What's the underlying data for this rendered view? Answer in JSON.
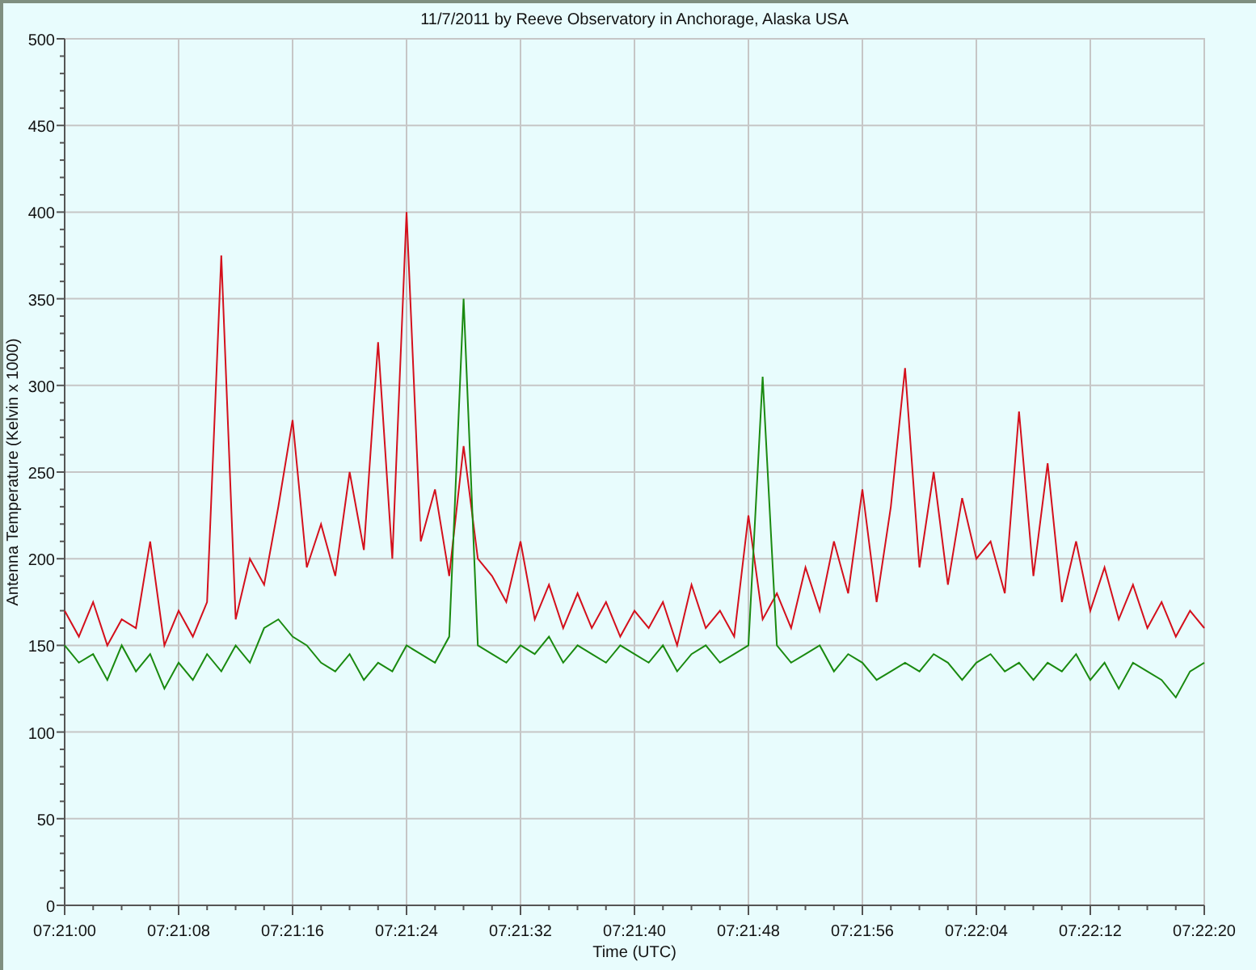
{
  "chart_data": {
    "type": "line",
    "title": "11/7/2011  by  Reeve Observatory  in  Anchorage, Alaska  USA",
    "xlabel": "Time (UTC)",
    "ylabel": "Antenna Temperature (Kelvin x 1000)",
    "categories": [
      "07:21:00",
      null,
      null,
      null,
      null,
      null,
      null,
      null,
      "07:21:08",
      null,
      null,
      null,
      null,
      null,
      null,
      null,
      "07:21:16",
      null,
      null,
      null,
      null,
      null,
      null,
      null,
      "07:21:24",
      null,
      null,
      null,
      null,
      null,
      null,
      null,
      "07:21:32",
      null,
      null,
      null,
      null,
      null,
      null,
      null,
      "07:21:40",
      null,
      null,
      null,
      null,
      null,
      null,
      null,
      "07:21:48",
      null,
      null,
      null,
      null,
      null,
      null,
      null,
      "07:21:56",
      null,
      null,
      null,
      null,
      null,
      null,
      null,
      "07:22:04",
      null,
      null,
      null,
      null,
      null,
      null,
      null,
      "07:22:12",
      null,
      null,
      null,
      null,
      null,
      null,
      null,
      "07:22:20"
    ],
    "series": [
      {
        "color": "#d4101c",
        "values": [
          170,
          155,
          175,
          150,
          165,
          160,
          210,
          150,
          170,
          155,
          175,
          375,
          165,
          200,
          185,
          230,
          280,
          195,
          220,
          190,
          250,
          205,
          325,
          200,
          400,
          210,
          240,
          190,
          265,
          200,
          190,
          175,
          210,
          165,
          185,
          160,
          180,
          160,
          175,
          155,
          170,
          160,
          175,
          150,
          185,
          160,
          170,
          155,
          225,
          165,
          180,
          160,
          195,
          170,
          210,
          180,
          240,
          175,
          230,
          310,
          195,
          250,
          185,
          235,
          200,
          210,
          180,
          285,
          190,
          255,
          175,
          210,
          170,
          195,
          165,
          185,
          160,
          175,
          155,
          170,
          160
        ]
      },
      {
        "color": "#1a8a10",
        "values": [
          150,
          140,
          145,
          130,
          150,
          135,
          145,
          125,
          140,
          130,
          145,
          135,
          150,
          140,
          160,
          165,
          155,
          150,
          140,
          135,
          145,
          130,
          140,
          135,
          150,
          145,
          140,
          155,
          350,
          150,
          145,
          140,
          150,
          145,
          155,
          140,
          150,
          145,
          140,
          150,
          145,
          140,
          150,
          135,
          145,
          150,
          140,
          145,
          150,
          305,
          150,
          140,
          145,
          150,
          135,
          145,
          140,
          130,
          135,
          140,
          135,
          145,
          140,
          130,
          140,
          145,
          135,
          140,
          130,
          140,
          135,
          145,
          130,
          140,
          125,
          140,
          135,
          130,
          120,
          135,
          140
        ]
      }
    ],
    "grid": true,
    "ylim": [
      0,
      500
    ],
    "yticks": [
      0,
      50,
      100,
      150,
      200,
      250,
      300,
      350,
      400,
      450,
      500
    ]
  }
}
